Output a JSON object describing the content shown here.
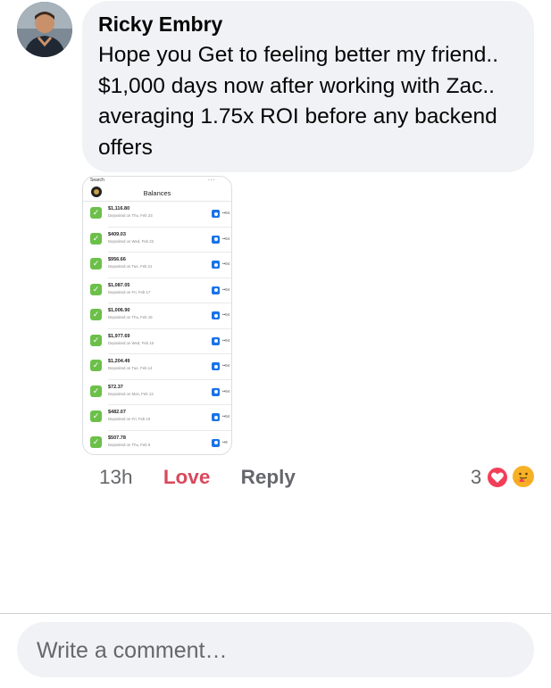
{
  "comment": {
    "author": "Ricky Embry",
    "message": "Hope you Get to feeling better my friend.. $1,000 days now after working with Zac.. averaging 1.75x ROI before any backend offers",
    "time": "13h",
    "love_label": "Love",
    "reply_label": "Reply",
    "reaction_count": "3",
    "reactions": [
      "heart-icon",
      "care-hug-icon"
    ]
  },
  "attachment": {
    "status_left": "Search",
    "status_right": "...",
    "title": "Balances",
    "rows": [
      {
        "amount": "$1,116.80",
        "date": "Deposited on Thu, Feb 23",
        "account": "••94"
      },
      {
        "amount": "$409.03",
        "date": "Deposited on Wed, Feb 22",
        "account": "••94"
      },
      {
        "amount": "$956.66",
        "date": "Deposited on Tue, Feb 21",
        "account": "••94"
      },
      {
        "amount": "$1,087.05",
        "date": "Deposited on Fri, Feb 17",
        "account": "••94"
      },
      {
        "amount": "$1,006.90",
        "date": "Deposited on Thu, Feb 16",
        "account": "••94"
      },
      {
        "amount": "$1,977.69",
        "date": "Deposited on Wed, Feb 15",
        "account": "••94"
      },
      {
        "amount": "$1,204.49",
        "date": "Deposited on Tue, Feb 14",
        "account": "••94"
      },
      {
        "amount": "$72.37",
        "date": "Deposited on Mon, Feb 13",
        "account": "••94"
      },
      {
        "amount": "$482.07",
        "date": "Deposited on Fri, Feb 10",
        "account": "••94"
      },
      {
        "amount": "$507.78",
        "date": "Deposited on Thu, Feb 9",
        "account": "••9"
      }
    ]
  },
  "composer": {
    "placeholder": "Write a comment…"
  },
  "colors": {
    "love": "#d9485b",
    "bubble": "#f0f2f5",
    "check": "#6cc04a",
    "bank": "#1a73e8"
  }
}
